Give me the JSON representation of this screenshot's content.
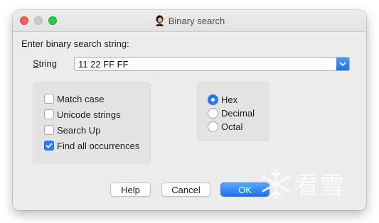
{
  "window": {
    "title": "Binary search",
    "app_icon": "user-avatar-icon"
  },
  "dialog": {
    "prompt": "Enter binary search string:",
    "string_label_accel": "S",
    "string_label_rest": "tring",
    "string_value": "11 22 FF FF"
  },
  "options": {
    "match_case": {
      "label": "Match case",
      "checked": false
    },
    "unicode_strings": {
      "label": "Unicode strings",
      "checked": false
    },
    "search_up": {
      "label": "Search Up",
      "checked": false
    },
    "find_all": {
      "label": "Find all occurrences",
      "checked": true
    }
  },
  "radix": {
    "hex": {
      "label": "Hex",
      "selected": true
    },
    "decimal": {
      "label": "Decimal",
      "selected": false
    },
    "octal": {
      "label": "Octal",
      "selected": false
    }
  },
  "buttons": {
    "help": "Help",
    "cancel": "Cancel",
    "ok": "OK"
  },
  "watermark": {
    "text": "看雪",
    "icon": "snowflake-logo-icon"
  },
  "colors": {
    "accent": "#2a7cf6",
    "close": "#fe5f57",
    "maximize": "#29c940"
  }
}
